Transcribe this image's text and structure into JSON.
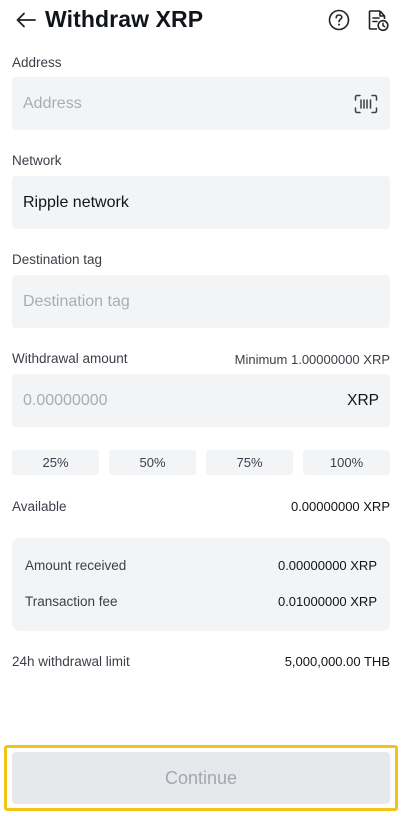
{
  "header": {
    "title": "Withdraw XRP"
  },
  "address": {
    "label": "Address",
    "placeholder": "Address"
  },
  "network": {
    "label": "Network",
    "value": "Ripple network"
  },
  "destination_tag": {
    "label": "Destination tag",
    "placeholder": "Destination tag"
  },
  "amount": {
    "label": "Withdrawal amount",
    "minimum": "Minimum 1.00000000 XRP",
    "placeholder": "0.00000000",
    "currency": "XRP"
  },
  "percent_buttons": [
    "25%",
    "50%",
    "75%",
    "100%"
  ],
  "available": {
    "label": "Available",
    "value": "0.00000000 XRP"
  },
  "summary": {
    "amount_received_label": "Amount received",
    "amount_received_value": "0.00000000 XRP",
    "transaction_fee_label": "Transaction fee",
    "transaction_fee_value": "0.01000000 XRP"
  },
  "limit": {
    "label": "24h withdrawal limit",
    "value": "5,000,000.00 THB"
  },
  "continue_label": "Continue",
  "colors": {
    "highlight": "#f2c318",
    "field_bg": "#f3f4f6",
    "disabled_text": "#a3a8b0"
  }
}
